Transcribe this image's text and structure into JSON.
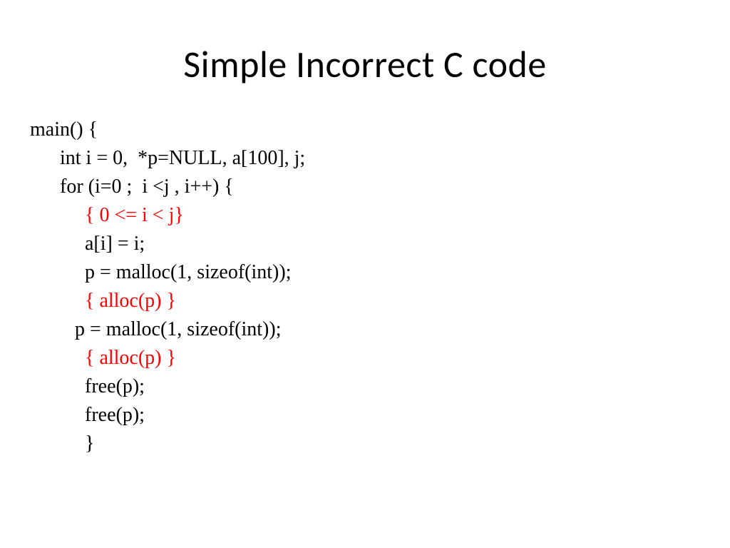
{
  "title": "Simple Incorrect C code",
  "code": {
    "l1": "main() {",
    "l2": "      int i = 0,  *p=NULL, a[100], j;",
    "l3": "      for (i=0 ;  i <j , i++) {",
    "l4a": "           ",
    "l4b": "{ 0 <= i < j}",
    "l5": "           a[i] = i;",
    "l6": "           p = malloc(1, sizeof(int));",
    "l7a": "           ",
    "l7b": "{ alloc(p) }",
    "l8": "         p = malloc(1, sizeof(int));",
    "l9a": "           ",
    "l9b": "{ alloc(p) }",
    "l10": "           free(p);",
    "l11": "           free(p);",
    "l12": "           }"
  }
}
